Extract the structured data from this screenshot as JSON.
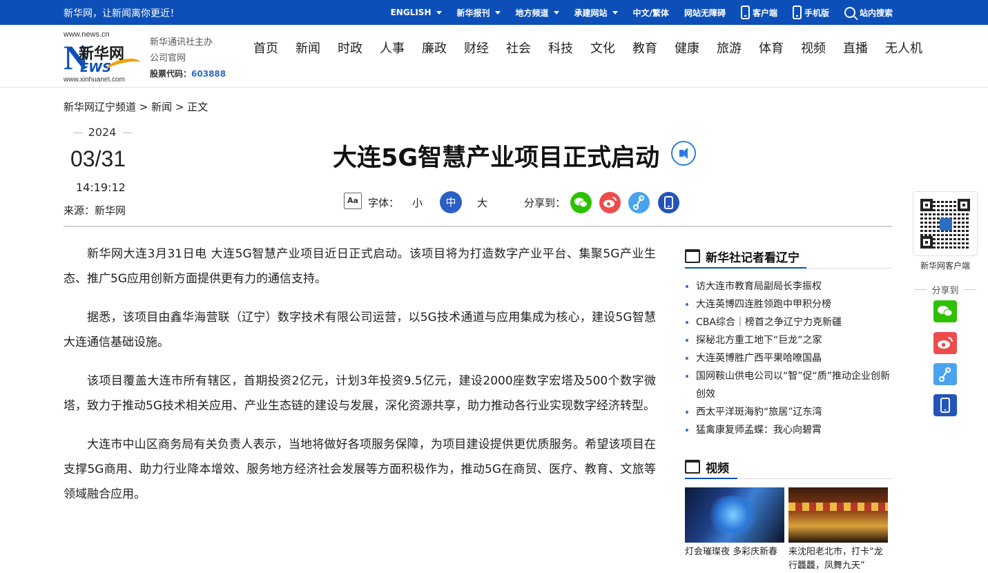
{
  "topbar": {
    "slogan": "新华网，让新闻离你更近！",
    "links": [
      {
        "label": "ENGLISH",
        "dropdown": true
      },
      {
        "label": "新华报刊",
        "dropdown": true
      },
      {
        "label": "地方频道",
        "dropdown": true
      },
      {
        "label": "承建网站",
        "dropdown": true
      },
      {
        "label": "中文/繁体",
        "dropdown": false
      },
      {
        "label": "网站无障碍",
        "dropdown": false
      }
    ],
    "client_label": "客户端",
    "mobile_label": "手机版",
    "search_label": "站内搜索"
  },
  "logo": {
    "url_top": "www.news.cn",
    "brand": "新华网",
    "letter_n": "N",
    "letters_ews": "EWS",
    "url_bottom": "www.xinhuanet.com"
  },
  "org": {
    "line1": "新华通讯社主办",
    "line2": "公司官网",
    "stock_label": "股票代码：",
    "stock_code": "603888"
  },
  "nav": [
    "首页",
    "新闻",
    "时政",
    "人事",
    "廉政",
    "财经",
    "社会",
    "科技",
    "文化",
    "教育",
    "健康",
    "旅游",
    "体育",
    "视频",
    "直播",
    "无人机"
  ],
  "breadcrumb": "新华网辽宁频道 > 新闻 > 正文",
  "article_meta": {
    "year": "2024",
    "month_day": "03/31",
    "time": "14:19:12",
    "source": "来源：新华网"
  },
  "article": {
    "title": "大连5G智慧产业项目正式启动",
    "paragraphs": [
      "新华网大连3月31日电 大连5G智慧产业项目近日正式启动。该项目将为打造数字产业平台、集聚5G产业生态、推广5G应用创新方面提供更有力的通信支持。",
      "据悉，该项目由鑫华海营联（辽宁）数字技术有限公司运营，以5G技术通道与应用集成为核心，建设5G智慧大连通信基础设施。",
      "该项目覆盖大连市所有辖区，首期投资2亿元，计划3年投资9.5亿元，建设2000座数字宏塔及500个数字微塔，致力于推动5G技术相关应用、产业生态链的建设与发展，深化资源共享，助力推动各行业实现数字经济转型。",
      "大连市中山区商务局有关负责人表示，当地将做好各项服务保障，为项目建设提供更优质服务。希望该项目在支撑5G商用、助力行业降本增效、服务地方经济社会发展等方面积极作为，推动5G在商贸、医疗、教育、文旅等领域融合应用。"
    ]
  },
  "toolbar": {
    "aa_icon_text": "Aa",
    "font_label": "字体：",
    "font_small": "小",
    "font_medium": "中",
    "font_large": "大",
    "share_label": "分享到："
  },
  "sidebar": {
    "section1_title": "新华社记者看辽宁",
    "news": [
      "访大连市教育局副局长李振权",
      "大连英博四连胜领跑中甲积分榜",
      "CBA综合｜榜首之争辽宁力克新疆",
      "探秘北方重工地下“巨龙”之家",
      "大连英博胜广西平果哈嘹国晶",
      "国网鞍山供电公司以“智”促“质”推动企业创新创效",
      "西太平洋斑海豹“旅居”辽东湾",
      "猛禽康复师孟蝶：我心向碧霄"
    ],
    "section2_title": "视频",
    "videos": [
      {
        "caption": "灯会璀璨夜 多彩庆新春"
      },
      {
        "caption": "来沈阳老北市，打卡“龙行龘龘，凤舞九天”"
      }
    ]
  },
  "float_panel": {
    "qr_caption": "新华网客户端",
    "share_label": "分享到"
  },
  "colors": {
    "brand_blue": "#0c4fb8",
    "wechat_green": "#2ec100",
    "weibo_red": "#ee4b4b",
    "link_blue": "#4aa3ee",
    "mobile_blue": "#2454b8"
  },
  "icons": [
    "phone-icon",
    "tablet-icon",
    "search-icon",
    "speaker-icon",
    "font-size-icon",
    "wechat-icon",
    "weibo-icon",
    "link-icon",
    "mobile-icon",
    "qr-code-icon",
    "section-icon"
  ]
}
